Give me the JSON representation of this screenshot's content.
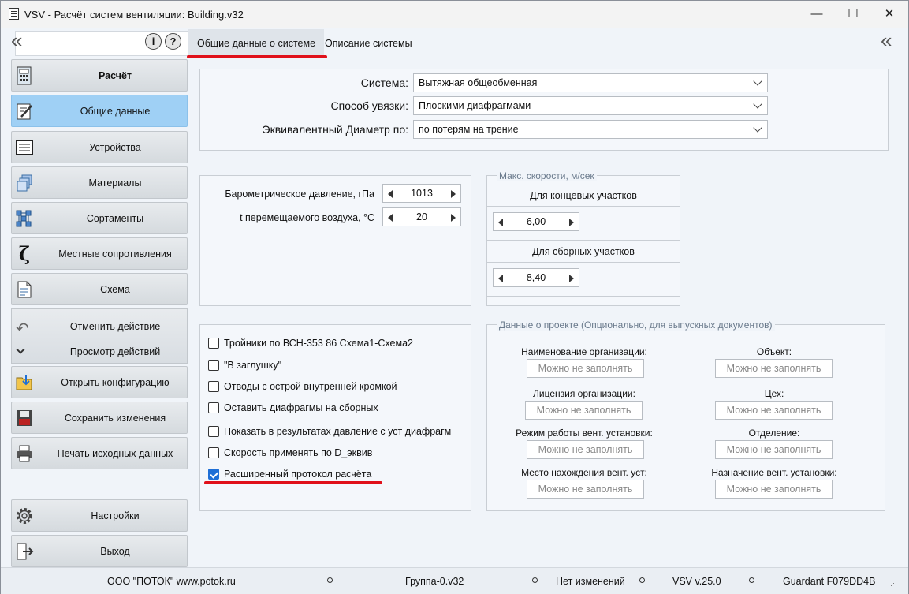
{
  "window": {
    "title": "VSV - Расчёт систем вентиляции: Building.v32",
    "minimize": "—",
    "maximize": "☐",
    "close": "✕"
  },
  "left_panel": {
    "collapse": "«",
    "info_button": "i",
    "help_button": "?",
    "calc_header": "Расчёт",
    "items": [
      {
        "label": "Общие данные",
        "icon": "edit-document-icon"
      },
      {
        "label": "Устройства",
        "icon": "device-icon"
      },
      {
        "label": "Материалы",
        "icon": "materials-icon"
      },
      {
        "label": "Сортаменты",
        "icon": "assortment-icon"
      },
      {
        "label": "Местные сопротивления",
        "icon": "zeta-icon"
      },
      {
        "label": "Схема",
        "icon": "scheme-icon"
      }
    ],
    "undo": "Отменить действие",
    "history": "Просмотр действий",
    "open_config": "Открыть конфигурацию",
    "save": "Сохранить изменения",
    "print": "Печать исходных данных",
    "settings": "Настройки",
    "exit": "Выход"
  },
  "tabs": {
    "general": "Общие данные о системе",
    "description": "Описание системы",
    "collapse_right": "«"
  },
  "system": {
    "system_label": "Система:",
    "system_value": "Вытяжная  общеобменная",
    "link_label": "Способ увязки:",
    "link_value": "Плоскими диафрагмами",
    "diam_label": "Эквивалентный Диаметр по:",
    "diam_value": "по потерям на трение"
  },
  "params": {
    "pressure_label": "Барометрическое давление, гПа",
    "pressure_value": "1013",
    "temp_label": "t перемещаемого воздуха, °С",
    "temp_value": "20"
  },
  "speeds": {
    "legend": "Макс. скорости, м/сек",
    "end_label": "Для концевых участков",
    "end_value": "6,00",
    "collect_label": "Для сборных участков",
    "collect_value": "8,40"
  },
  "options": [
    {
      "label": "Тройники по  ВСН-353 86 Схема1-Схема2",
      "checked": false
    },
    {
      "label": "\"В заглушку\"",
      "checked": false
    },
    {
      "label": "Отводы с острой внутренней кромкой",
      "checked": false
    },
    {
      "label": "Оставить диафрагмы на сборных",
      "checked": false
    },
    {
      "label": "Показать в результатах давление с уст диафрагм",
      "checked": false
    },
    {
      "label": "Скорость применять по D_эквив",
      "checked": false
    },
    {
      "label": "Расширенный протокол расчёта",
      "checked": true
    }
  ],
  "project": {
    "legend": "Данные о проекте (Опционально, для выпускных документов)",
    "placeholder": "Можно не заполнять",
    "left_fields": [
      "Наименование организации:",
      "Лицензия организации:",
      "Режим работы вент. установки:",
      "Место нахождения вент. уст:"
    ],
    "right_fields": [
      "Объект:",
      "Цех:",
      "Отделение:",
      "Назначение вент. установки:"
    ]
  },
  "status": {
    "company": "ООО \"ПОТОК\" www.potok.ru",
    "group": "Группа-0.v32",
    "changes": "Нет изменений",
    "version": "VSV v.25.0",
    "guardant": "Guardant F079DD4B"
  },
  "colors": {
    "accent_active": "#9fd0f5",
    "highlight_red": "#e0101a",
    "checkbox_blue": "#1f6fd6"
  }
}
